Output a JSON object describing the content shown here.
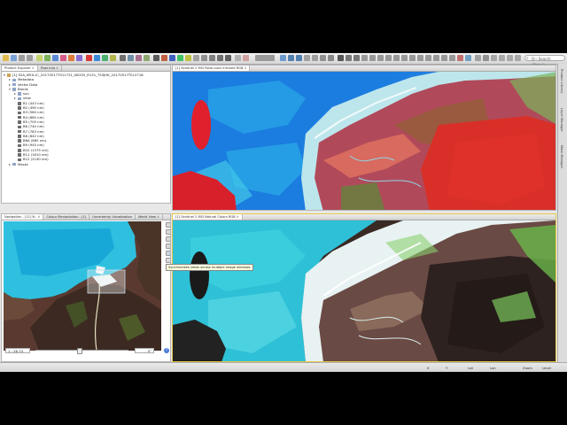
{
  "app": {
    "search_placeholder": "Q~ Search (Ctrl+I)"
  },
  "product_explorer": {
    "tabs": [
      {
        "label": "Product Explorer",
        "active": true
      },
      {
        "label": "Pixel Info",
        "active": false
      }
    ],
    "product": "[1] S2A_MSIL1C_20170517T011721_N0205_R131_T53JHK_20170517T012718",
    "nodes": {
      "metadata": "Metadata",
      "vector": "Vector Data",
      "bands": "Bands",
      "sun": "sun",
      "view": "view",
      "masks": "Masks"
    },
    "bands": [
      "B1 (443 nm)",
      "B2 (490 nm)",
      "B3 (560 nm)",
      "B4 (665 nm)",
      "B5 (705 nm)",
      "B6 (740 nm)",
      "B7 (783 nm)",
      "B8 (842 nm)",
      "B8A (865 nm)",
      "B9 (945 nm)",
      "B10 (1375 nm)",
      "B11 (1610 nm)",
      "B12 (2190 nm)"
    ]
  },
  "navigation": {
    "tabs": [
      {
        "label": "Navigation - [11] N..",
        "active": true
      },
      {
        "label": "Colour Manipulation - [1]",
        "active": false
      },
      {
        "label": "Uncertainty Visualisation",
        "active": false
      },
      {
        "label": "World View",
        "active": false
      }
    ],
    "scale": "1 : 26.74",
    "rotation": "0°"
  },
  "top_view": {
    "title": "[1] Sentinel 2 MSI False-color Infrared RGB"
  },
  "bottom_view": {
    "title": "[1] Sentinel 2 MSI Natural Colors RGB"
  },
  "tooltip": "Synchronises views across multiple image windows",
  "right_tabs": [
    "Product Library",
    "Layer Manager",
    "Mask Manager"
  ],
  "status": {
    "x": "X",
    "y": "Y",
    "lat": "Lat",
    "lon": "Lon",
    "zoom": "Zoom",
    "level": "Level"
  }
}
